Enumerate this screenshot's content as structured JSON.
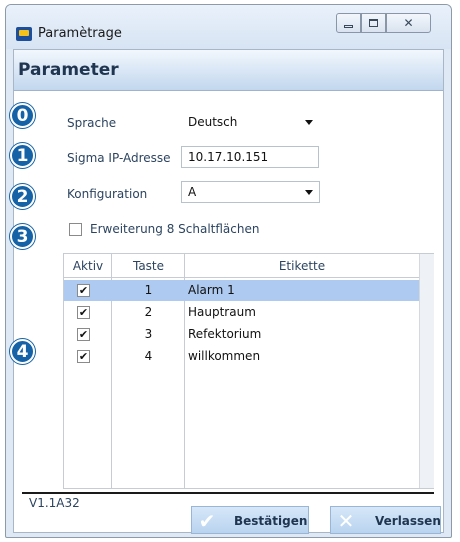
{
  "window": {
    "title": "Paramètrage",
    "controls": {
      "minimize": "minimize",
      "maximize": "maximize",
      "close": "close"
    }
  },
  "header": {
    "title": "Parameter"
  },
  "form": {
    "language_label": "Sprache",
    "language_value": "Deutsch",
    "ip_label": "Sigma IP-Adresse",
    "ip_value": "10.17.10.151",
    "config_label": "Konfiguration",
    "config_value": "A",
    "extension_label": "Erweiterung 8 Schaltflächen",
    "extension_checked": false
  },
  "table": {
    "columns": [
      "Aktiv",
      "Taste",
      "Etikette"
    ],
    "rows": [
      {
        "active": "✔",
        "key": "1",
        "label": "Alarm 1",
        "selected": true
      },
      {
        "active": "✔",
        "key": "2",
        "label": "Hauptraum",
        "selected": false
      },
      {
        "active": "✔",
        "key": "3",
        "label": "Refektorium",
        "selected": false
      },
      {
        "active": "✔",
        "key": "4",
        "label": "willkommen",
        "selected": false
      }
    ]
  },
  "badges": [
    "0",
    "1",
    "2",
    "3",
    "4"
  ],
  "footer": {
    "version": "V1.1A32",
    "confirm_label": "Bestätigen",
    "cancel_label": "Verlassen"
  },
  "icons": {
    "app": "app-logo-icon",
    "confirm": "checkmark-icon",
    "cancel": "x-icon"
  },
  "colors": {
    "badge": "#1563a6",
    "selection": "#aecaf0",
    "header_band": "#c2d7ee",
    "button": "#b9d3ef"
  }
}
